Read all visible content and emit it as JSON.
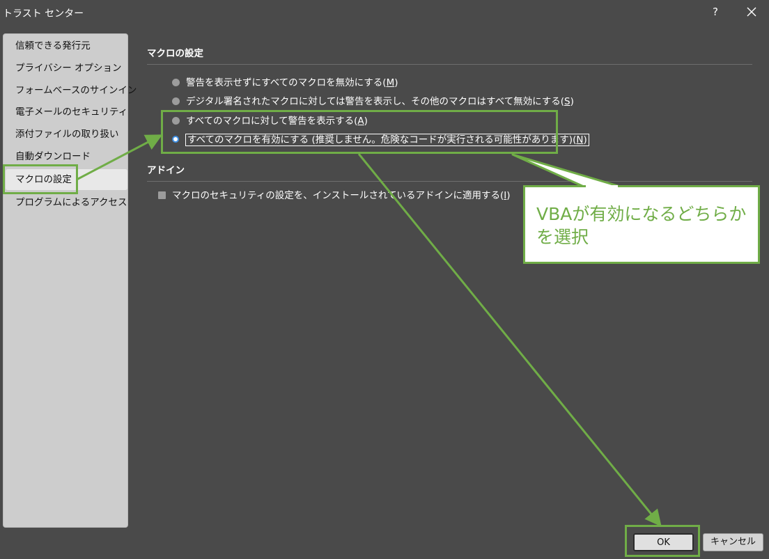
{
  "window": {
    "title": "トラスト センター",
    "help_label": "?"
  },
  "sidebar": {
    "items": [
      {
        "label": "信頼できる発行元"
      },
      {
        "label": "プライバシー オプション"
      },
      {
        "label": "フォームベースのサインイン"
      },
      {
        "label": "電子メールのセキュリティ"
      },
      {
        "label": "添付ファイルの取り扱い"
      },
      {
        "label": "自動ダウンロード"
      },
      {
        "label": "マクロの設定"
      },
      {
        "label": "プログラムによるアクセス"
      }
    ],
    "selected": "マクロの設定"
  },
  "macro_section": {
    "title": "マクロの設定",
    "options": [
      {
        "label": "警告を表示せずにすべてのマクロを無効にする(",
        "key": "M",
        "suffix": ")",
        "checked": false
      },
      {
        "label": "デジタル署名されたマクロに対しては警告を表示し、その他のマクロはすべて無効にする(",
        "key": "S",
        "suffix": ")",
        "checked": false
      },
      {
        "label": "すべてのマクロに対して警告を表示する(",
        "key": "A",
        "suffix": ")",
        "checked": false
      },
      {
        "label": "すべてのマクロを有効にする (推奨しません。危険なコードが実行される可能性があります)(",
        "key": "N",
        "suffix": ")",
        "checked": true
      }
    ]
  },
  "addin_section": {
    "title": "アドイン",
    "checkbox": {
      "label": "マクロのセキュリティの設定を、インストールされているアドインに適用する(",
      "key": "I",
      "suffix": ")",
      "checked": false
    }
  },
  "annotation": {
    "callout_text": "VBAが有効になるどちらかを選択",
    "color": "#70ad47"
  },
  "buttons": {
    "ok_label": "OK",
    "cancel_label": "キャンセル"
  },
  "colors": {
    "background": "#4a4a4a",
    "sidebar_bg": "#cdcdcd",
    "accent_radio": "#3d8de0",
    "annotation_green": "#70ad47"
  }
}
